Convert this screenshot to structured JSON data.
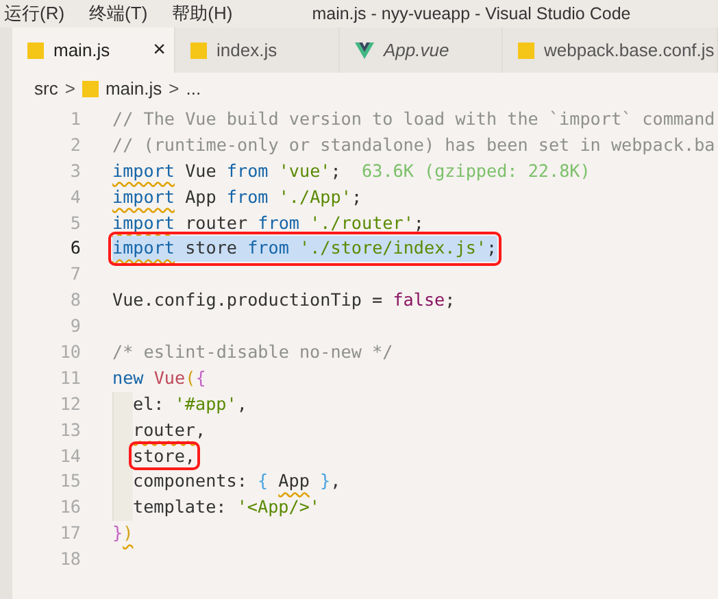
{
  "menu": [
    "运行(R)",
    "终端(T)",
    "帮助(H)"
  ],
  "window": {
    "title": "main.js - nyy-vueapp - Visual Studio Code"
  },
  "tabs": [
    {
      "label": "main.js",
      "kind": "js",
      "selected": true,
      "preview": false,
      "close": "×"
    },
    {
      "label": "index.js",
      "kind": "js",
      "selected": false,
      "preview": false
    },
    {
      "label": "App.vue",
      "kind": "vue",
      "selected": false,
      "preview": true
    },
    {
      "label": "webpack.base.conf.js",
      "kind": "js",
      "selected": false,
      "preview": false
    }
  ],
  "breadcrumb": [
    {
      "label": "src",
      "kind": "folder"
    },
    {
      "label": "main.js",
      "kind": "js"
    },
    {
      "label": "...",
      "kind": "symbol"
    }
  ],
  "breadcrumb_separator": ">",
  "lines": [
    {
      "number": "1",
      "selected": false,
      "tokens": [
        {
          "t": "// The Vue build version to load with the `import` command",
          "kind": "comment"
        }
      ]
    },
    {
      "number": "2",
      "selected": false,
      "tokens": [
        {
          "t": "// (runtime-only or standalone) has been set in webpack.ba",
          "kind": "comment"
        }
      ]
    },
    {
      "number": "3",
      "selected": false,
      "tokens": [
        {
          "t": "import",
          "kind": "keyword",
          "squiggle": true
        },
        {
          "t": " Vue ",
          "kind": "plain"
        },
        {
          "t": "from",
          "kind": "keyword"
        },
        {
          "t": " 'vue'",
          "kind": "string"
        },
        {
          "t": ";",
          "kind": "plain"
        },
        {
          "t": "  63.6K (gzipped: 22.8K)",
          "kind": "hint"
        }
      ]
    },
    {
      "number": "4",
      "selected": false,
      "tokens": [
        {
          "t": "import",
          "kind": "keyword",
          "squiggle": true
        },
        {
          "t": " App ",
          "kind": "plain"
        },
        {
          "t": "from",
          "kind": "keyword"
        },
        {
          "t": " './App'",
          "kind": "string"
        },
        {
          "t": ";",
          "kind": "plain"
        }
      ]
    },
    {
      "number": "5",
      "selected": false,
      "tokens": [
        {
          "t": "import",
          "kind": "keyword",
          "squiggle": true
        },
        {
          "t": " router ",
          "kind": "plain"
        },
        {
          "t": "from",
          "kind": "keyword"
        },
        {
          "t": " './router'",
          "kind": "string"
        },
        {
          "t": ";",
          "kind": "plain"
        }
      ]
    },
    {
      "number": "6",
      "selected": true,
      "boxed": true,
      "tokens": [
        {
          "t": "import",
          "kind": "keyword",
          "squiggle": true
        },
        {
          "t": " store ",
          "kind": "plain"
        },
        {
          "t": "from",
          "kind": "keyword"
        },
        {
          "t": " './store/index.js'",
          "kind": "string"
        },
        {
          "t": ";",
          "kind": "plain"
        }
      ]
    },
    {
      "number": "7",
      "selected": false
    },
    {
      "number": "8",
      "selected": false,
      "tokens": [
        {
          "t": "Vue.config.productionTip = ",
          "kind": "plain"
        },
        {
          "t": "false",
          "kind": "literal"
        },
        {
          "t": ";",
          "kind": "plain"
        }
      ]
    },
    {
      "number": "9",
      "selected": false
    },
    {
      "number": "10",
      "selected": false,
      "tokens": [
        {
          "t": "/* eslint-disable no-new */",
          "kind": "comment"
        }
      ]
    },
    {
      "number": "11",
      "selected": false,
      "tokens": [
        {
          "t": "new",
          "kind": "keyword"
        },
        {
          "t": " Vue",
          "kind": "class"
        },
        {
          "t": "(",
          "kind": "paren"
        },
        {
          "t": "{",
          "kind": "brace"
        }
      ]
    },
    {
      "number": "12",
      "selected": false,
      "indent": true,
      "tokens": [
        {
          "t": "el: ",
          "kind": "plain"
        },
        {
          "t": "'#app'",
          "kind": "string"
        },
        {
          "t": ",",
          "kind": "plain"
        }
      ]
    },
    {
      "number": "13",
      "selected": false,
      "indent": true,
      "tokens": [
        {
          "t": "router",
          "kind": "plain",
          "squiggle": true
        },
        {
          "t": ",",
          "kind": "plain"
        }
      ]
    },
    {
      "number": "14",
      "selected": false,
      "indent": true,
      "tokens": [
        {
          "t": "store,",
          "kind": "plain",
          "boxed": true
        }
      ]
    },
    {
      "number": "15",
      "selected": false,
      "indent": true,
      "tokens": [
        {
          "t": "components: ",
          "kind": "plain"
        },
        {
          "t": "{ ",
          "kind": "brace2"
        },
        {
          "t": "App",
          "kind": "plain",
          "squiggle": true
        },
        {
          "t": " }",
          "kind": "brace2"
        },
        {
          "t": ",",
          "kind": "plain"
        }
      ]
    },
    {
      "number": "16",
      "selected": false,
      "indent": true,
      "tokens": [
        {
          "t": "template: ",
          "kind": "plain"
        },
        {
          "t": "'<App/>'",
          "kind": "string"
        }
      ]
    },
    {
      "number": "17",
      "selected": false,
      "tokens": [
        {
          "t": "}",
          "kind": "brace"
        },
        {
          "t": ")",
          "kind": "paren",
          "squiggle": true
        }
      ]
    },
    {
      "number": "18",
      "selected": false
    }
  ]
}
